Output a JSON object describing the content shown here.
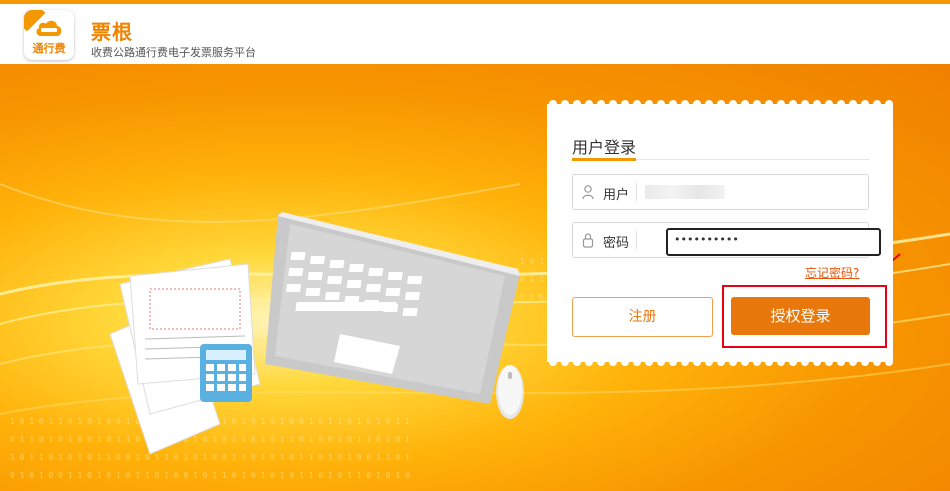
{
  "header": {
    "logo_text": "通行费",
    "brand": "票根",
    "tagline": "收费公路通行费电子发票服务平台"
  },
  "login": {
    "title": "用户登录",
    "username_label": "用户",
    "password_label": "密码",
    "password_value": "••••••••••",
    "forgot_link": "忘记密码?",
    "register_button": "注册",
    "login_button": "授权登录"
  },
  "colors": {
    "brand_orange": "#f39800",
    "button_orange": "#e8780c",
    "highlight_red": "#e60012"
  }
}
